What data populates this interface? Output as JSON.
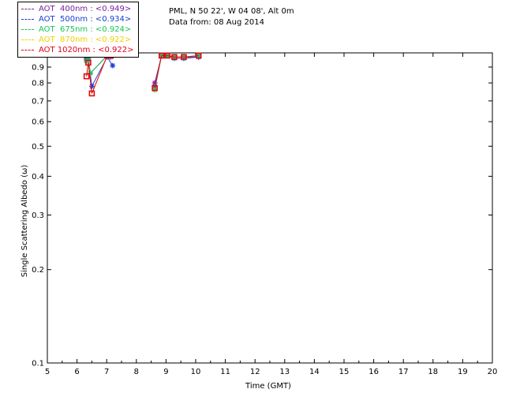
{
  "legend": [
    {
      "label": "AOT  400nm : <0.949>",
      "color": "#7b1fa2"
    },
    {
      "label": "AOT  500nm : <0.934>",
      "color": "#1a3fd6"
    },
    {
      "label": "AOT  675nm : <0.924>",
      "color": "#19c45a"
    },
    {
      "label": "AOT  870nm : <0.922>",
      "color": "#f0d000"
    },
    {
      "label": "AOT 1020nm : <0.922>",
      "color": "#e3001a"
    }
  ],
  "info": {
    "site": "PML, N 50 22', W 04 08', Alt 0m",
    "date": "Data from: 08 Aug 2014"
  },
  "chart_data": {
    "type": "scatter",
    "xlabel": "Time (GMT)",
    "ylabel": "Single Scattering Albedo (ω)",
    "xlim": [
      5,
      20
    ],
    "ylim": [
      0.1,
      1.0
    ],
    "yscale": "log",
    "x_ticks": [
      5,
      6,
      7,
      8,
      9,
      10,
      11,
      12,
      13,
      14,
      15,
      16,
      17,
      18,
      19,
      20
    ],
    "y_ticks": [
      "0.1",
      "0.2",
      "0.3",
      "0.4",
      "0.5",
      "0.6",
      "0.7",
      "0.8",
      "0.9",
      "1.0"
    ],
    "grid": false,
    "series": [
      {
        "name": "AOT  400nm : <0.949>",
        "color": "#7b1fa2",
        "marker": "star",
        "points": [
          [
            6.32,
            0.96
          ],
          [
            6.38,
            0.97
          ],
          [
            6.45,
            0.86
          ],
          [
            7.02,
            0.98
          ],
          [
            7.14,
            0.97
          ],
          [
            8.62,
            0.8
          ],
          [
            8.85,
            0.98
          ],
          [
            9.05,
            0.98
          ],
          [
            9.28,
            0.97
          ],
          [
            9.6,
            0.97
          ],
          [
            10.1,
            0.97
          ]
        ]
      },
      {
        "name": "AOT  500nm : <0.934>",
        "color": "#1a3fd6",
        "marker": "star",
        "points": [
          [
            6.32,
            0.95
          ],
          [
            6.38,
            0.96
          ],
          [
            6.5,
            0.78
          ],
          [
            7.02,
            0.97
          ],
          [
            7.2,
            0.91
          ],
          [
            8.62,
            0.78
          ],
          [
            8.85,
            0.98
          ],
          [
            9.05,
            0.98
          ],
          [
            9.28,
            0.96
          ],
          [
            9.6,
            0.96
          ],
          [
            10.1,
            0.97
          ]
        ]
      },
      {
        "name": "AOT  675nm : <0.924>",
        "color": "#19c45a",
        "marker": "star",
        "points": [
          [
            6.32,
            0.94
          ],
          [
            6.38,
            0.95
          ],
          [
            6.45,
            0.86
          ],
          [
            7.02,
            0.98
          ],
          [
            7.14,
            0.98
          ],
          [
            8.62,
            0.76
          ],
          [
            8.85,
            0.98
          ],
          [
            9.05,
            0.98
          ],
          [
            9.28,
            0.97
          ],
          [
            9.6,
            0.97
          ],
          [
            10.1,
            0.98
          ]
        ]
      },
      {
        "name": "AOT  870nm : <0.922>",
        "color": "#f0d000",
        "marker": "square",
        "points": [
          [
            6.32,
            0.84
          ],
          [
            6.38,
            0.93
          ],
          [
            6.5,
            0.74
          ],
          [
            7.02,
            0.98
          ],
          [
            7.14,
            0.98
          ],
          [
            8.62,
            0.77
          ],
          [
            8.85,
            0.98
          ],
          [
            9.05,
            0.98
          ],
          [
            9.28,
            0.97
          ],
          [
            9.6,
            0.97
          ],
          [
            10.1,
            0.98
          ]
        ]
      },
      {
        "name": "AOT 1020nm : <0.922>",
        "color": "#e3001a",
        "marker": "square",
        "points": [
          [
            6.32,
            0.84
          ],
          [
            6.38,
            0.93
          ],
          [
            6.5,
            0.74
          ],
          [
            7.02,
            0.98
          ],
          [
            7.14,
            0.98
          ],
          [
            8.62,
            0.77
          ],
          [
            8.85,
            0.98
          ],
          [
            9.05,
            0.98
          ],
          [
            9.28,
            0.97
          ],
          [
            9.6,
            0.97
          ],
          [
            10.1,
            0.98
          ]
        ]
      }
    ]
  }
}
